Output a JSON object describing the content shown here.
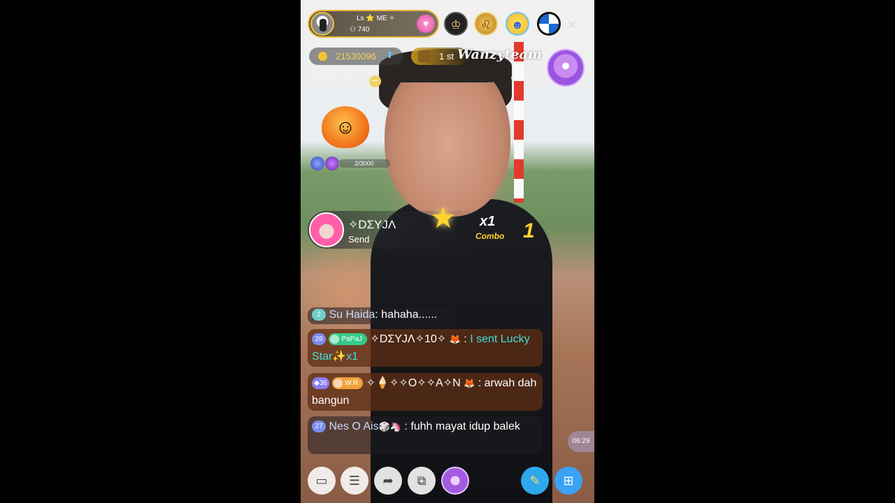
{
  "host": {
    "name": "Ls ⭐ ME ✧",
    "viewers": "740",
    "follow_icon": "heart-cup-icon"
  },
  "top_icons": [
    "crown-person-icon",
    "lion-badge-icon",
    "vip-bird-icon",
    "bmw-logo-icon"
  ],
  "close": "×",
  "coins": {
    "value": "21530096",
    "arrow": "⬆"
  },
  "rank": {
    "label": "1 st"
  },
  "watermark": "Wanzyteam",
  "minus_symbol": "−",
  "level_progress": {
    "text": "2/3000",
    "fraction": 0.0007
  },
  "gift_banner": {
    "sender": "✧DΣYJΛ",
    "action": "Send",
    "multiplier": "x1",
    "combo_label": "Combo",
    "combo_count": "1"
  },
  "chat": [
    {
      "level": "2",
      "user": "Su Haida",
      "sep": ": ",
      "text": "hahaha......"
    },
    {
      "level": "26",
      "tag": "PaPaJ",
      "user": "✧DΣYJΛ✧10✧",
      "deco": "🦊",
      "sep": " : ",
      "text": "I sent Lucky Star✨x1"
    },
    {
      "level": "◆36",
      "tag": "W.R",
      "user": "✧🍦✧✧O✧✧A✧N",
      "deco": "🦊",
      "sep": " : ",
      "text": "arwah dah bangun"
    },
    {
      "level": "27",
      "user": "Nes O Ais",
      "deco": "🎲🦄",
      "sep": " : ",
      "text": "fuhh mayat idup balek"
    }
  ],
  "timer": "06:29",
  "bottom_icons": [
    "chat-icon",
    "menu-list-icon",
    "share-icon",
    "crop-icon",
    "event-icon",
    "wand-icon",
    "gift-icon"
  ],
  "colors": {
    "gold_border": "#e8b93a",
    "coin_text": "#f5d35a",
    "combo_yellow": "#ffd22e",
    "chat_cyan": "#3fe0d7"
  }
}
